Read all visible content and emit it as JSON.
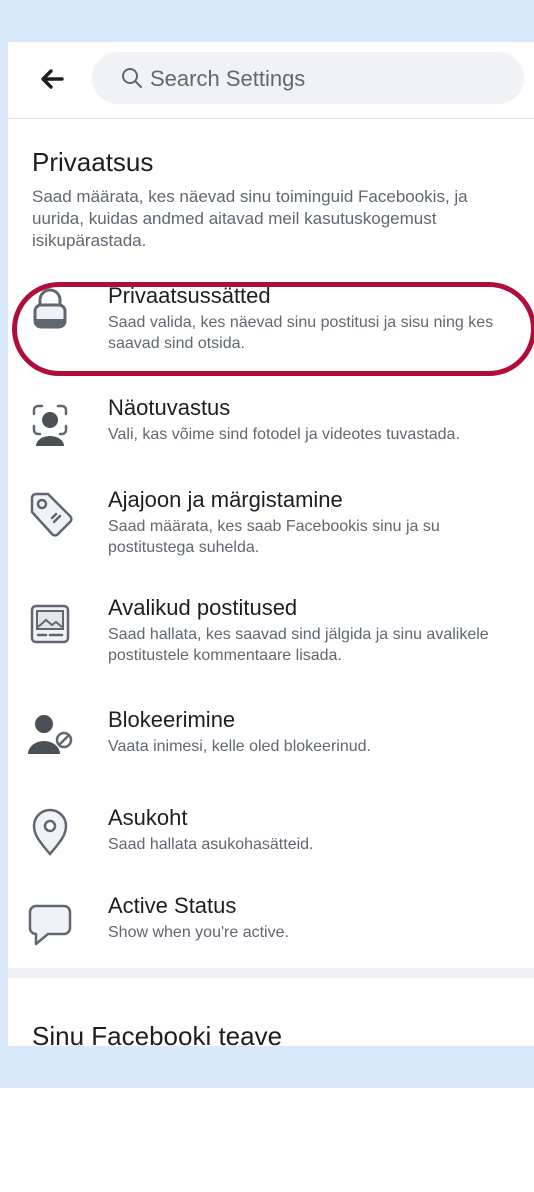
{
  "search": {
    "placeholder": "Search Settings"
  },
  "privacy": {
    "title": "Privaatsus",
    "description": "Saad määrata, kes näevad sinu toiminguid Facebookis, ja uurida, kuidas andmed aitavad meil kasutuskogemust isikupärastada."
  },
  "items": [
    {
      "title": "Privaatsussätted",
      "desc": "Saad valida, kes näevad sinu postitusi ja sisu ning kes saavad sind otsida.",
      "icon": "lock-icon"
    },
    {
      "title": "Näotuvastus",
      "desc": "Vali, kas võime sind fotodel ja videotes tuvastada.",
      "icon": "face-recognition-icon"
    },
    {
      "title": "Ajajoon ja märgistamine",
      "desc": "Saad määrata, kes saab Facebookis sinu ja su postitustega suhelda.",
      "icon": "tag-icon"
    },
    {
      "title": "Avalikud postitused",
      "desc": "Saad hallata, kes saavad sind jälgida ja sinu avalikele postitustele kommentaare lisada.",
      "icon": "public-posts-icon"
    },
    {
      "title": "Blokeerimine",
      "desc": "Vaata inimesi, kelle oled blokeerinud.",
      "icon": "blocked-user-icon"
    },
    {
      "title": "Asukoht",
      "desc": "Saad hallata asukohasätteid.",
      "icon": "location-pin-icon"
    },
    {
      "title": "Active Status",
      "desc": "Show when you're active.",
      "icon": "chat-bubble-icon"
    }
  ],
  "section2": {
    "title": "Sinu Facebooki teave"
  },
  "colors": {
    "highlight": "#b00d3b",
    "frame": "#d9e8fb",
    "icon": "#606770"
  }
}
